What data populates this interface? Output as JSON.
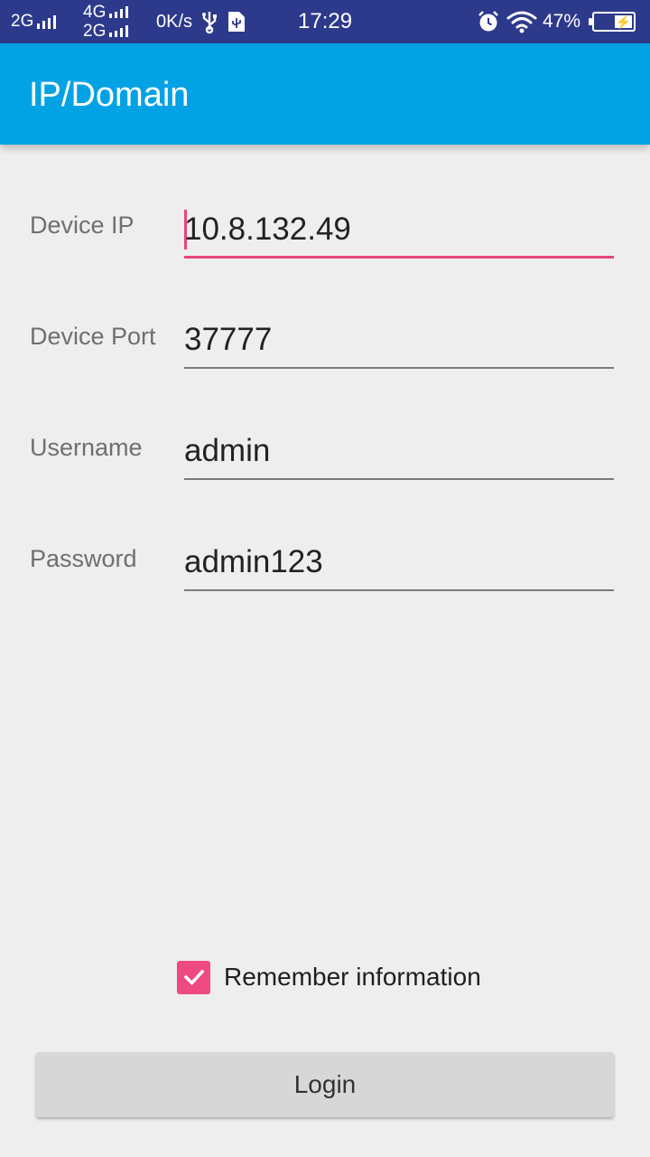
{
  "status_bar": {
    "sim1_label": "2G",
    "sim2_top_label": "4G",
    "sim2_bottom_label": "2G",
    "net_speed": "0K/s",
    "time": "17:29",
    "battery_percent": "47%",
    "battery_level": 0.47,
    "icons": [
      "signal-icon",
      "usb-icon",
      "usb-debug-icon",
      "alarm-icon",
      "wifi-icon",
      "battery-icon"
    ]
  },
  "app_bar": {
    "title": "IP/Domain"
  },
  "form": {
    "device_ip": {
      "label": "Device IP",
      "value": "10.8.132.49"
    },
    "device_port": {
      "label": "Device Port",
      "value": "37777"
    },
    "username": {
      "label": "Username",
      "value": "admin"
    },
    "password": {
      "label": "Password",
      "value": "admin123"
    }
  },
  "remember": {
    "label": "Remember information",
    "checked": true
  },
  "login_button": {
    "label": "Login"
  },
  "colors": {
    "status_bar": "#2d3a8c",
    "app_bar": "#03a2e5",
    "accent": "#ee4a80",
    "background": "#eeeeee"
  }
}
